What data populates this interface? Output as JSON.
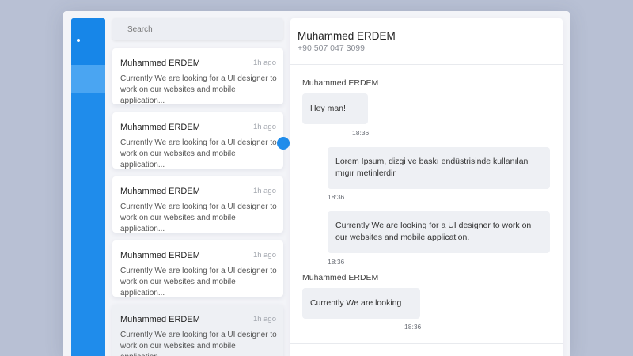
{
  "search": {
    "placeholder": "Search"
  },
  "conversations": [
    {
      "name": "Muhammed ERDEM",
      "time": "1h ago",
      "message": "Currently We are looking for a UI designer to work on our websites and mobile application..."
    },
    {
      "name": "Muhammed ERDEM",
      "time": "1h ago",
      "message": "Currently We are looking for a UI designer to work on our websites and mobile application..."
    },
    {
      "name": "Muhammed ERDEM",
      "time": "1h ago",
      "message": "Currently We are looking for a UI designer to work on our websites and mobile application..."
    },
    {
      "name": "Muhammed ERDEM",
      "time": "1h ago",
      "message": "Currently We are looking for a UI designer to work on our websites and mobile application..."
    },
    {
      "name": "Muhammed ERDEM",
      "time": "1h ago",
      "message": "Currently We are looking for a UI designer to work on our websites and mobile application..."
    }
  ],
  "chat": {
    "contact_name": "Muhammed ERDEM",
    "contact_phone": "+90 507 047 3099",
    "messages": [
      {
        "sender": "Muhammed ERDEM",
        "text": "Hey man!",
        "time": "18:36",
        "direction": "incoming"
      },
      {
        "sender": "",
        "text": "Lorem Ipsum, dizgi ve baskı endüstrisinde kullanılan mıgır metinlerdir",
        "time": "18:36",
        "direction": "outgoing"
      },
      {
        "sender": "",
        "text": "Currently We are looking for a UI designer to work on our websites and mobile application.",
        "time": "18:36",
        "direction": "outgoing"
      },
      {
        "sender": "Muhammed ERDEM",
        "text": "Currently We are looking",
        "time": "18:36",
        "direction": "incoming"
      }
    ]
  },
  "colors": {
    "accent": "#1f8ceb",
    "background": "#b8c0d4",
    "bubble": "#eef0f4"
  }
}
